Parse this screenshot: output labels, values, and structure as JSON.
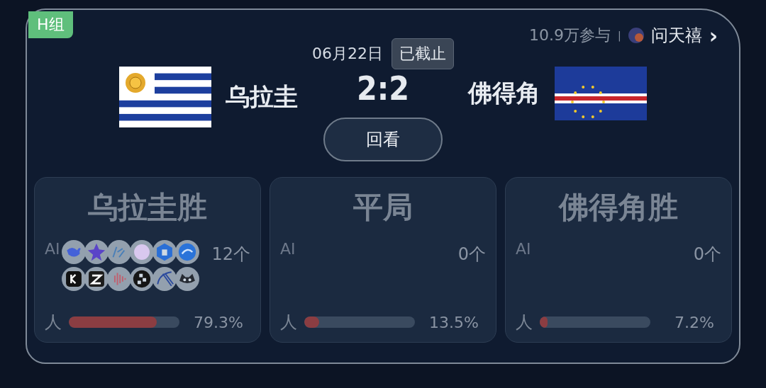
{
  "group_badge": "H组",
  "participants": "10.9万参与",
  "separator": "|",
  "user": {
    "name": "问天禧"
  },
  "user_chevron": "›",
  "match": {
    "date": "06月22日",
    "status": "已截止",
    "score": "2:2",
    "home": {
      "name": "乌拉圭",
      "flag": {
        "kind": "uruguay"
      }
    },
    "away": {
      "name": "佛得角",
      "flag": {
        "kind": "cape-verde"
      }
    },
    "replay_button": "回看"
  },
  "options": [
    {
      "label": "乌拉圭胜",
      "ai_label": "AI",
      "ai_count": "12个",
      "ai_icons": [
        {
          "kind": "whale"
        },
        {
          "kind": "star"
        },
        {
          "kind": "script"
        },
        {
          "kind": "orb"
        },
        {
          "kind": "cube"
        },
        {
          "kind": "swirl"
        },
        {
          "kind": "k"
        },
        {
          "kind": "z"
        },
        {
          "kind": "sound"
        },
        {
          "kind": "blocks"
        },
        {
          "kind": "alpha"
        },
        {
          "kind": "raccoon"
        }
      ],
      "people_label": "人",
      "level": 0.793,
      "reading": "79.3%"
    },
    {
      "label": "平局",
      "ai_label": "AI",
      "ai_count": "0个",
      "people_label": "人",
      "level": 0.135,
      "reading": "13.5%"
    },
    {
      "label": "佛得角胜",
      "ai_label": "AI",
      "ai_count": "0个",
      "people_label": "人",
      "level": 0.072,
      "reading": "7.2%"
    }
  ]
}
